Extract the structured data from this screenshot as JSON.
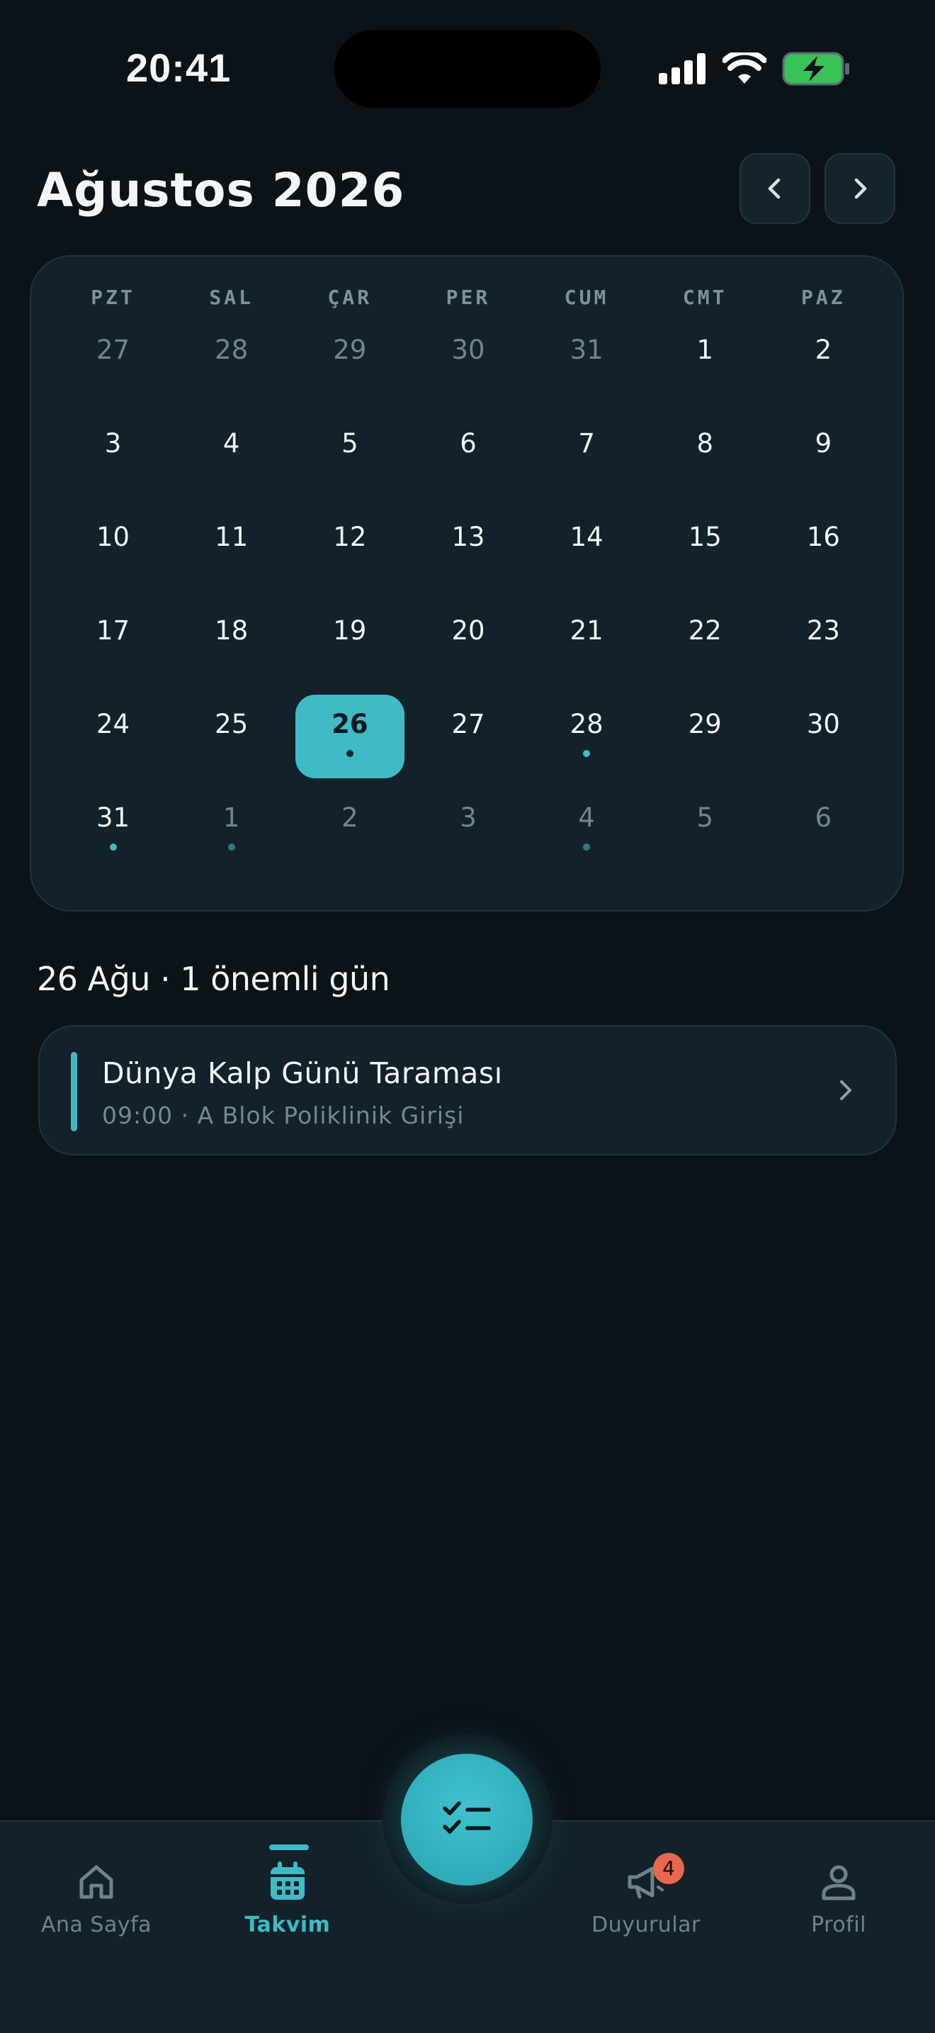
{
  "status_bar": {
    "time": "20:41"
  },
  "header": {
    "month_title": "Ağustos 2026"
  },
  "calendar": {
    "weekdays": [
      "PZT",
      "SAL",
      "ÇAR",
      "PER",
      "CUM",
      "CMT",
      "PAZ"
    ],
    "days": [
      {
        "n": "27",
        "muted": true,
        "dot": false
      },
      {
        "n": "28",
        "muted": true,
        "dot": false
      },
      {
        "n": "29",
        "muted": true,
        "dot": false
      },
      {
        "n": "30",
        "muted": true,
        "dot": false
      },
      {
        "n": "31",
        "muted": true,
        "dot": false
      },
      {
        "n": "1",
        "muted": false,
        "dot": false
      },
      {
        "n": "2",
        "muted": false,
        "dot": false
      },
      {
        "n": "3",
        "muted": false,
        "dot": false
      },
      {
        "n": "4",
        "muted": false,
        "dot": false
      },
      {
        "n": "5",
        "muted": false,
        "dot": false
      },
      {
        "n": "6",
        "muted": false,
        "dot": false
      },
      {
        "n": "7",
        "muted": false,
        "dot": false
      },
      {
        "n": "8",
        "muted": false,
        "dot": false
      },
      {
        "n": "9",
        "muted": false,
        "dot": false
      },
      {
        "n": "10",
        "muted": false,
        "dot": false
      },
      {
        "n": "11",
        "muted": false,
        "dot": false
      },
      {
        "n": "12",
        "muted": false,
        "dot": false
      },
      {
        "n": "13",
        "muted": false,
        "dot": false
      },
      {
        "n": "14",
        "muted": false,
        "dot": false
      },
      {
        "n": "15",
        "muted": false,
        "dot": false
      },
      {
        "n": "16",
        "muted": false,
        "dot": false
      },
      {
        "n": "17",
        "muted": false,
        "dot": false
      },
      {
        "n": "18",
        "muted": false,
        "dot": false
      },
      {
        "n": "19",
        "muted": false,
        "dot": false
      },
      {
        "n": "20",
        "muted": false,
        "dot": false
      },
      {
        "n": "21",
        "muted": false,
        "dot": false
      },
      {
        "n": "22",
        "muted": false,
        "dot": false
      },
      {
        "n": "23",
        "muted": false,
        "dot": false
      },
      {
        "n": "24",
        "muted": false,
        "dot": false
      },
      {
        "n": "25",
        "muted": false,
        "dot": false
      },
      {
        "n": "26",
        "muted": false,
        "dot": true,
        "selected": true
      },
      {
        "n": "27",
        "muted": false,
        "dot": false
      },
      {
        "n": "28",
        "muted": false,
        "dot": true
      },
      {
        "n": "29",
        "muted": false,
        "dot": false
      },
      {
        "n": "30",
        "muted": false,
        "dot": false
      },
      {
        "n": "31",
        "muted": false,
        "dot": true
      },
      {
        "n": "1",
        "muted": true,
        "dot": true
      },
      {
        "n": "2",
        "muted": true,
        "dot": false
      },
      {
        "n": "3",
        "muted": true,
        "dot": false
      },
      {
        "n": "4",
        "muted": true,
        "dot": true
      },
      {
        "n": "5",
        "muted": true,
        "dot": false
      },
      {
        "n": "6",
        "muted": true,
        "dot": false
      }
    ]
  },
  "selected_day": {
    "heading": "26 Ağu · 1 önemli gün"
  },
  "events": [
    {
      "title": "Dünya Kalp Günü Taraması",
      "subtitle": "09:00 · A Blok Poliklinik Girişi"
    }
  ],
  "tab_bar": {
    "tabs": [
      {
        "label": "Ana Sayfa",
        "icon": "home-icon",
        "active": false
      },
      {
        "label": "Takvim",
        "icon": "calendar-icon",
        "active": true
      },
      {
        "label": "Duyurular",
        "icon": "megaphone-icon",
        "active": false,
        "badge": "4"
      },
      {
        "label": "Profil",
        "icon": "person-icon",
        "active": false
      }
    ],
    "fab_icon": "checklist-icon"
  },
  "colors": {
    "accent": "#3fbac6",
    "background": "#0b1218",
    "card": "#13222a",
    "badge": "#e8674f"
  }
}
